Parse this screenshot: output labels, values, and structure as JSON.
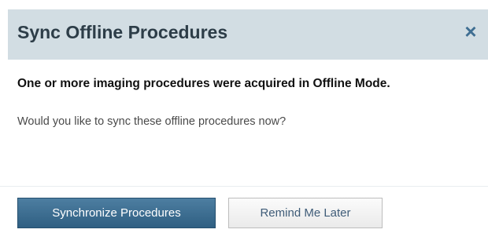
{
  "dialog": {
    "title": "Sync Offline Procedures",
    "close_glyph": "×",
    "close_icon": "close-icon",
    "headline": "One or more imaging procedures were acquired in Offline Mode.",
    "question": "Would you like to sync these offline procedures now?",
    "primary_button_label": "Synchronize Procedures",
    "secondary_button_label": "Remind Me Later"
  },
  "colors": {
    "titlebar_bg": "#d2dde3",
    "primary_button": "#3b6a8d",
    "close_icon": "#3f6e92"
  }
}
